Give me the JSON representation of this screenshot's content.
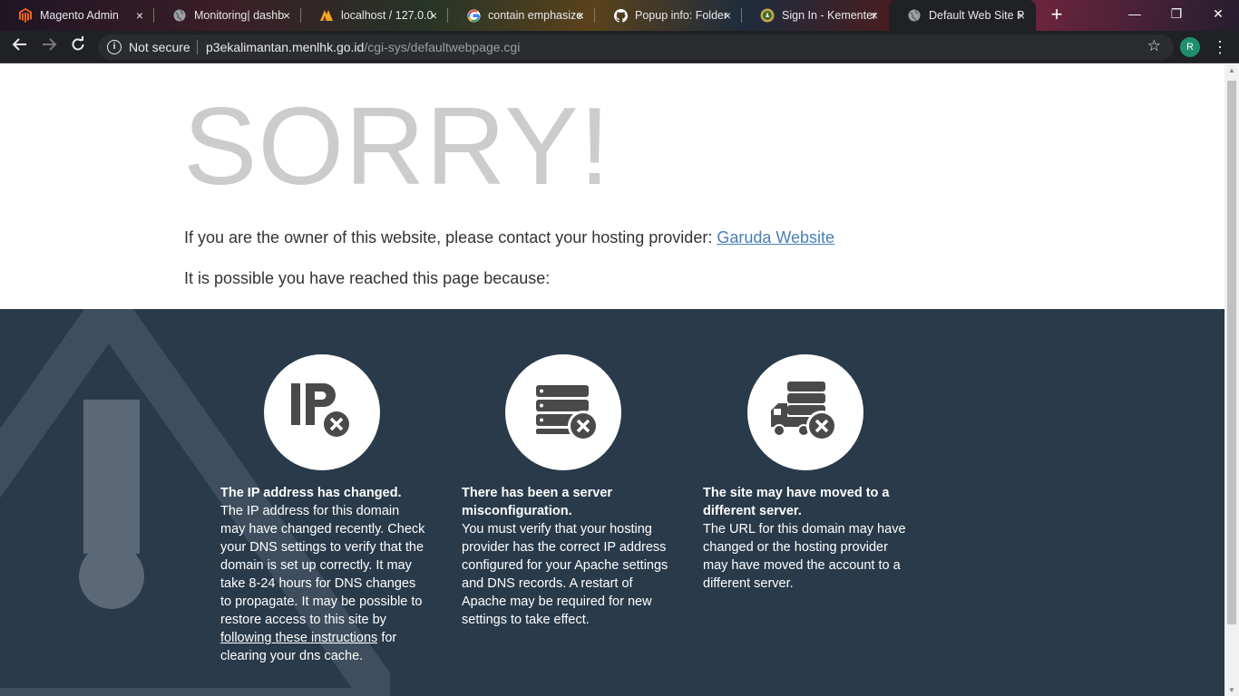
{
  "tabs": [
    {
      "title": "Magento Admin",
      "icon": "magento-icon"
    },
    {
      "title": "Monitoring| dashb",
      "icon": "globe-icon"
    },
    {
      "title": "localhost / 127.0.0",
      "icon": "phpmyadmin-icon"
    },
    {
      "title": "contain emphasize",
      "icon": "google-icon"
    },
    {
      "title": "Popup info: Folder",
      "icon": "github-icon"
    },
    {
      "title": "Sign In - Kementer",
      "icon": "ministry-logo-icon"
    },
    {
      "title": "Default Web Site P",
      "icon": "globe-icon",
      "active": true
    }
  ],
  "tab_close_glyph": "×",
  "new_tab_glyph": "+",
  "window": {
    "minimize": "—",
    "restore": "❐",
    "close": "✕"
  },
  "omnibox": {
    "security_label": "Not secure",
    "url_host": "p3ekalimantan.menlhk.go.id",
    "url_path": "/cgi-sys/defaultwebpage.cgi"
  },
  "profile_initial": "R",
  "page": {
    "heading": "SORRY!",
    "owner_text": "If you are the owner of this website, please contact your hosting provider: ",
    "provider_link": "Garuda Website",
    "reason_intro": "It is possible you have reached this page because:",
    "reasons": [
      {
        "icon": "ip-error-icon",
        "title": "The IP address has changed.",
        "text_before": "The IP address for this domain may have changed recently. Check your DNS settings to verify that the domain is set up correctly. It may take 8-24 hours for DNS changes to propagate. It may be possible to restore access to this site by ",
        "link": "following these instructions",
        "text_after": " for clearing your dns cache."
      },
      {
        "icon": "server-error-icon",
        "title": "There has been a server misconfiguration.",
        "text_before": "You must verify that your hosting provider has the correct IP address configured for your Apache settings and DNS records. A restart of Apache may be required for new settings to take effect."
      },
      {
        "icon": "server-moved-icon",
        "title": "The site may have moved to a different server.",
        "text_before": "The URL for this domain may have changed or the hosting provider may have moved the account to a different server."
      }
    ]
  },
  "colors": {
    "dark_band": "#293a4a",
    "heading": "#cccccc",
    "link": "#4a7fb5"
  }
}
